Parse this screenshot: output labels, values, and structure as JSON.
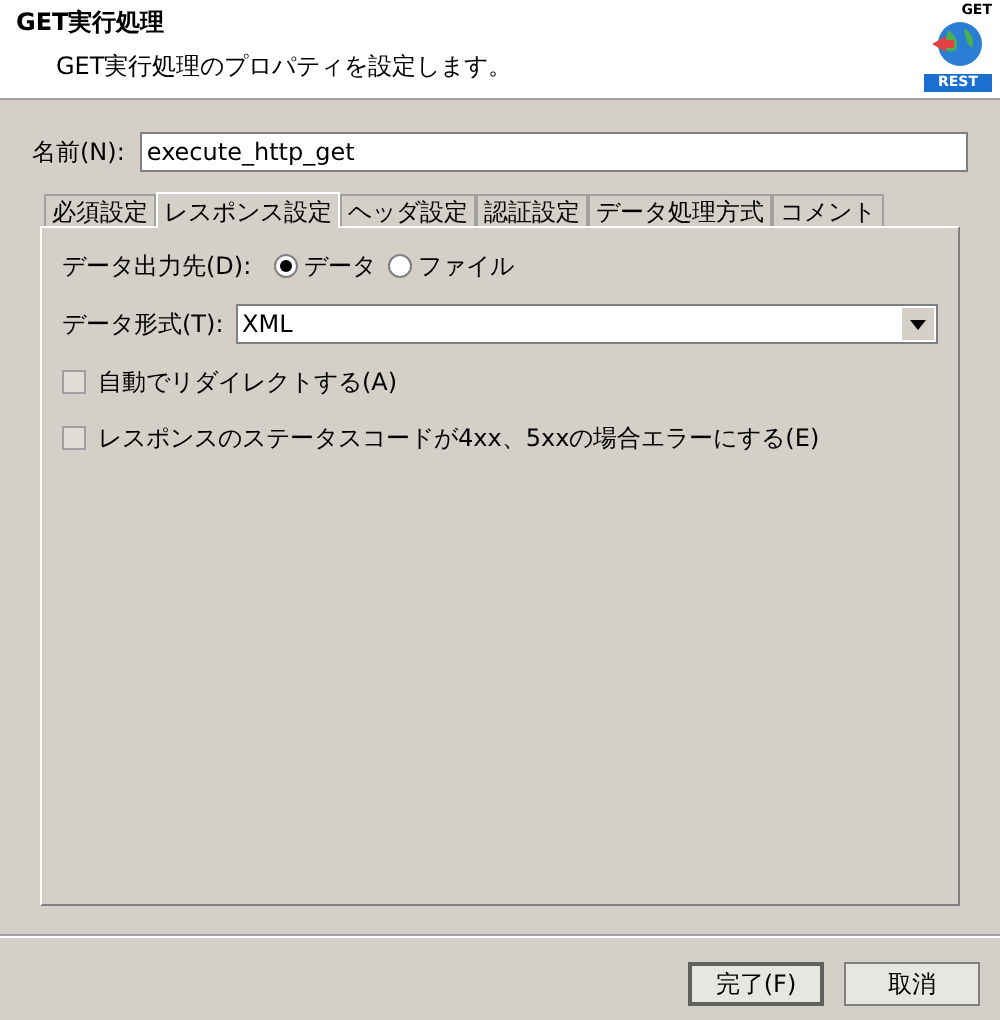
{
  "header": {
    "title": "GET実行処理",
    "subtitle": "GET実行処理のプロパティを設定します。",
    "icon_top_label": "GET",
    "icon_badge": "REST"
  },
  "name_field": {
    "label": "名前(N):",
    "value": "execute_http_get"
  },
  "tabs": [
    {
      "label": "必須設定",
      "selected": false
    },
    {
      "label": "レスポンス設定",
      "selected": true
    },
    {
      "label": "ヘッダ設定",
      "selected": false
    },
    {
      "label": "認証設定",
      "selected": false
    },
    {
      "label": "データ処理方式",
      "selected": false
    },
    {
      "label": "コメント",
      "selected": false
    }
  ],
  "output": {
    "label": "データ出力先(D):",
    "options": [
      {
        "label": "データ",
        "selected": true
      },
      {
        "label": "ファイル",
        "selected": false
      }
    ]
  },
  "format": {
    "label": "データ形式(T):",
    "value": "XML"
  },
  "checkboxes": [
    {
      "label": "自動でリダイレクトする(A)",
      "checked": false
    },
    {
      "label": "レスポンスのステータスコードが4xx、5xxの場合エラーにする(E)",
      "checked": false
    }
  ],
  "buttons": [
    {
      "label": "完了(F)",
      "default": true
    },
    {
      "label": "取消",
      "default": false
    }
  ]
}
